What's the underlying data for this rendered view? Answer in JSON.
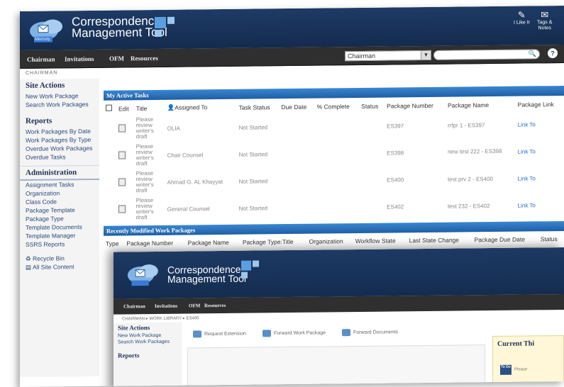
{
  "app": {
    "title_line1": "Correspondence",
    "title_line2": "Management Tool",
    "brand": "Mercury"
  },
  "header_buttons": [
    {
      "label": "I Like It"
    },
    {
      "label": "Tags &",
      "label2": "Notes"
    }
  ],
  "nav": {
    "items": [
      "Chairman",
      "Invitations",
      "OFM",
      "Resources"
    ],
    "scope_value": "Chairman"
  },
  "breadcrumb": "CHAIRMAN",
  "sidebar": {
    "site_actions_heading": "Site Actions",
    "site_actions": [
      "New Work Package",
      "Search Work Packages"
    ],
    "reports_heading": "Reports",
    "reports": [
      "Work Packages By Date",
      "Work Packages By Type",
      "Overdue Work Packages",
      "Overdue Tasks"
    ],
    "admin_heading": "Administration",
    "admin": [
      "Assignment Tasks",
      "Organization",
      "Class Code",
      "Package Template",
      "Package Type",
      "Template Documents",
      "Template Manager",
      "SSRS Reports"
    ],
    "extras": [
      "Recycle Bin",
      "All Site Content"
    ]
  },
  "tasks": {
    "title": "My Active Tasks",
    "columns": [
      "Edit",
      "Title",
      "Assigned To",
      "Task Status",
      "Due Date",
      "% Complete",
      "Status",
      "Package Number",
      "Package Name",
      "Package Link"
    ],
    "rows": [
      {
        "title": "Please review writer's draft",
        "assigned": "OLIA",
        "status": "Not Started",
        "number": "ES397",
        "name": "rrfpr 1 - ES397",
        "link": "Link To"
      },
      {
        "title": "Please review writer's draft",
        "assigned": "Chair Counsel",
        "status": "Not Started",
        "number": "ES398",
        "name": "new test 222 - ES398",
        "link": "Link To"
      },
      {
        "title": "Please review writer's draft",
        "assigned": "Ahmad G. AL Khayyat",
        "status": "Not Started",
        "number": "ES400",
        "name": "test prv 2 - ES400",
        "link": "Link To"
      },
      {
        "title": "Please review writer's draft",
        "assigned": "General Counsel",
        "status": "Not Started",
        "number": "ES402",
        "name": "test 232 - ES402",
        "link": "Link To"
      }
    ]
  },
  "recent": {
    "title": "Recently Modified Work Packages",
    "columns": [
      "Type",
      "Package Number",
      "Package Name",
      "Package Type:Title",
      "Organization",
      "Workflow State",
      "Last State Change",
      "Package Due Date",
      "Status"
    ]
  },
  "inner": {
    "nav": [
      "Chairman",
      "Invitations",
      "OFM",
      "Resources"
    ],
    "breadcrumb": "CHAIRMAN ▸ WORK LIBRARY ▸ ES400",
    "toolbar": [
      "Request Extension",
      "Forward Work Package",
      "Forward Documents"
    ],
    "side_heading": "Site Actions",
    "side_items": [
      "New Work Package",
      "Search Work Packages"
    ],
    "reports_heading": "Reports",
    "current_title": "Current Thi",
    "todo_label": "To Do",
    "please": "Please"
  },
  "colors": {
    "header": "#1e3b66",
    "bar": "#2a72bf",
    "link": "#2b6cc4"
  }
}
